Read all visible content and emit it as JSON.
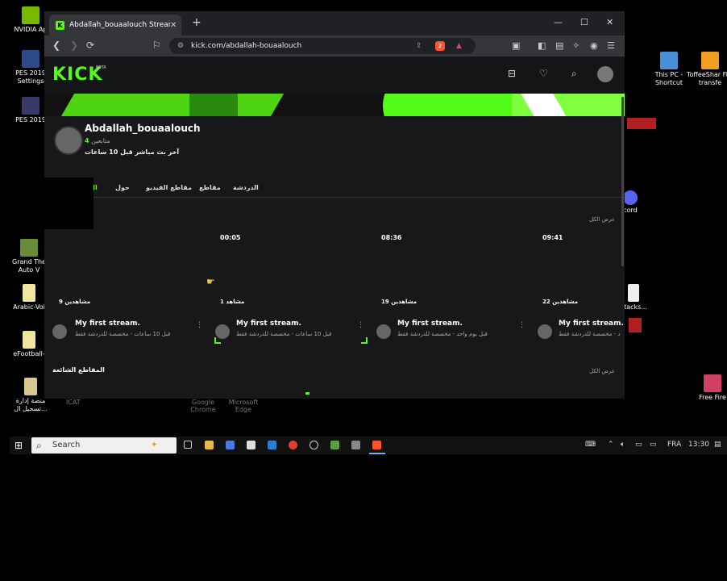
{
  "desktop": {
    "icons": [
      {
        "label": "NVIDIA Ap",
        "color": "#76b900"
      },
      {
        "label": "PES 2019 Settings",
        "color": "#2a4a8a"
      },
      {
        "label": "PES 2019",
        "color": "#3a3a6a"
      },
      {
        "label": "Grand The Auto V",
        "color": "#6a8a3a"
      },
      {
        "label": "Arabic-Voi",
        "color": "#f0e6a0"
      },
      {
        "label": "eFootball-",
        "color": "#f0e6a0"
      },
      {
        "label": "منصة إدارة تسجيل ال...",
        "color": "#d8c890"
      },
      {
        "label": "This PC - Shortcut",
        "color": "#4a90d9"
      },
      {
        "label": "ToffeeShar File transfe",
        "color": "#f0a020"
      },
      {
        "label": "cord",
        "color": "#5865f2"
      },
      {
        "label": "Stacks...",
        "color": "#eeeeee"
      },
      {
        "label": "Free Fire",
        "color": "#d04060"
      }
    ],
    "hidden_labels": [
      "Google Chrome",
      "Microsoft Edge",
      "ICAT"
    ]
  },
  "browser": {
    "tab_title": "Abdallah_bouaalouch Stream - V",
    "tab_favicon": "K",
    "url": "kick.com/abdallah-bouaalouch",
    "shield_badge": "2"
  },
  "site": {
    "logo": "KICK",
    "beta": "BETA",
    "accent": "#53fc18"
  },
  "profile": {
    "name": "Abdallah_bouaalouch",
    "followers_count": "4",
    "followers_label": "متابعين",
    "last_live": "آخر بث مباشر قبل 10 ساعات"
  },
  "tabs": [
    "الدردشة",
    "مقاطع",
    "مقاطع الفيديو",
    "حول",
    "ال"
  ],
  "videos": {
    "show_all": "عرض الكل",
    "items": [
      {
        "duration": "",
        "views": "9 مشاهدين",
        "title": "My first stream.",
        "sub": "قبل 10 ساعات - مخصصة للدردشة فقط"
      },
      {
        "duration": "00:05",
        "views": "1 مشاهد",
        "title": "My first stream.",
        "sub": "قبل 10 ساعات - مخصصة للدردشة فقط"
      },
      {
        "duration": "08:36",
        "views": "19 مشاهدين",
        "title": "My first stream.",
        "sub": "قبل يوم واحد - مخصصة للدردشة فقط"
      },
      {
        "duration": "09:41",
        "views": "22 مشاهدين",
        "title": "My first stream.",
        "sub": "د - مخصصة للدردشة فقط"
      }
    ]
  },
  "clips": {
    "title": "المقاطع الشائعة",
    "show_all": "عرض الكل"
  },
  "taskbar": {
    "search_placeholder": "Search",
    "lang": "FRA",
    "time": "13:30"
  }
}
